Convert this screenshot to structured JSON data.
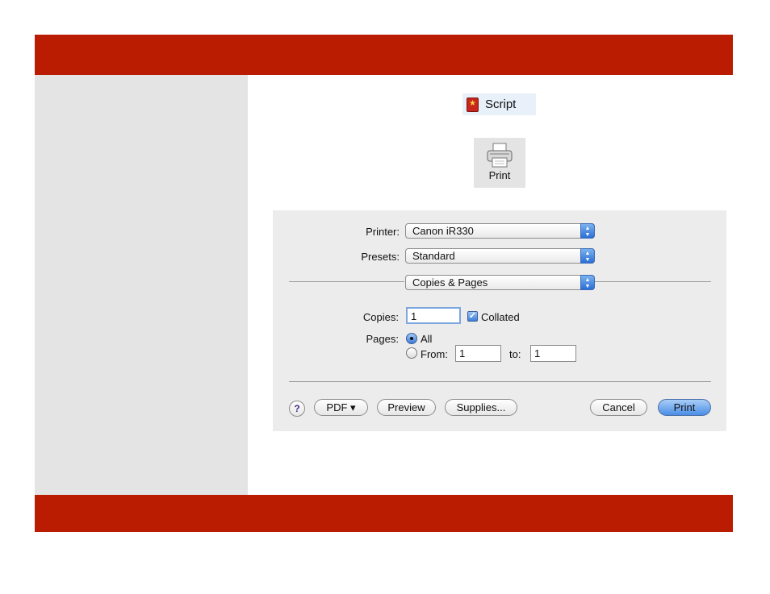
{
  "app": {
    "name": "Script"
  },
  "toolbar": {
    "print_label": "Print"
  },
  "print_dialog": {
    "printer": {
      "label": "Printer:",
      "value": "Canon iR330"
    },
    "presets": {
      "label": "Presets:",
      "value": "Standard"
    },
    "panel": {
      "value": "Copies & Pages"
    },
    "copies": {
      "label": "Copies:",
      "value": "1",
      "collated_label": "Collated",
      "collated": true
    },
    "pages": {
      "label": "Pages:",
      "all_label": "All",
      "from_label": "From:",
      "from_value": "1",
      "to_label": "to:",
      "to_value": "1",
      "selected": "all"
    },
    "buttons": {
      "help": "?",
      "pdf": "PDF ▾",
      "preview": "Preview",
      "supplies": "Supplies...",
      "cancel": "Cancel",
      "print": "Print"
    }
  },
  "colors": {
    "brand_bar": "#b91c00",
    "side_panel": "#e4e4e4",
    "dialog_bg": "#ececec",
    "accent": "#4b8ee6"
  },
  "icons": {
    "app": "script-app-icon",
    "print": "printer-icon"
  }
}
